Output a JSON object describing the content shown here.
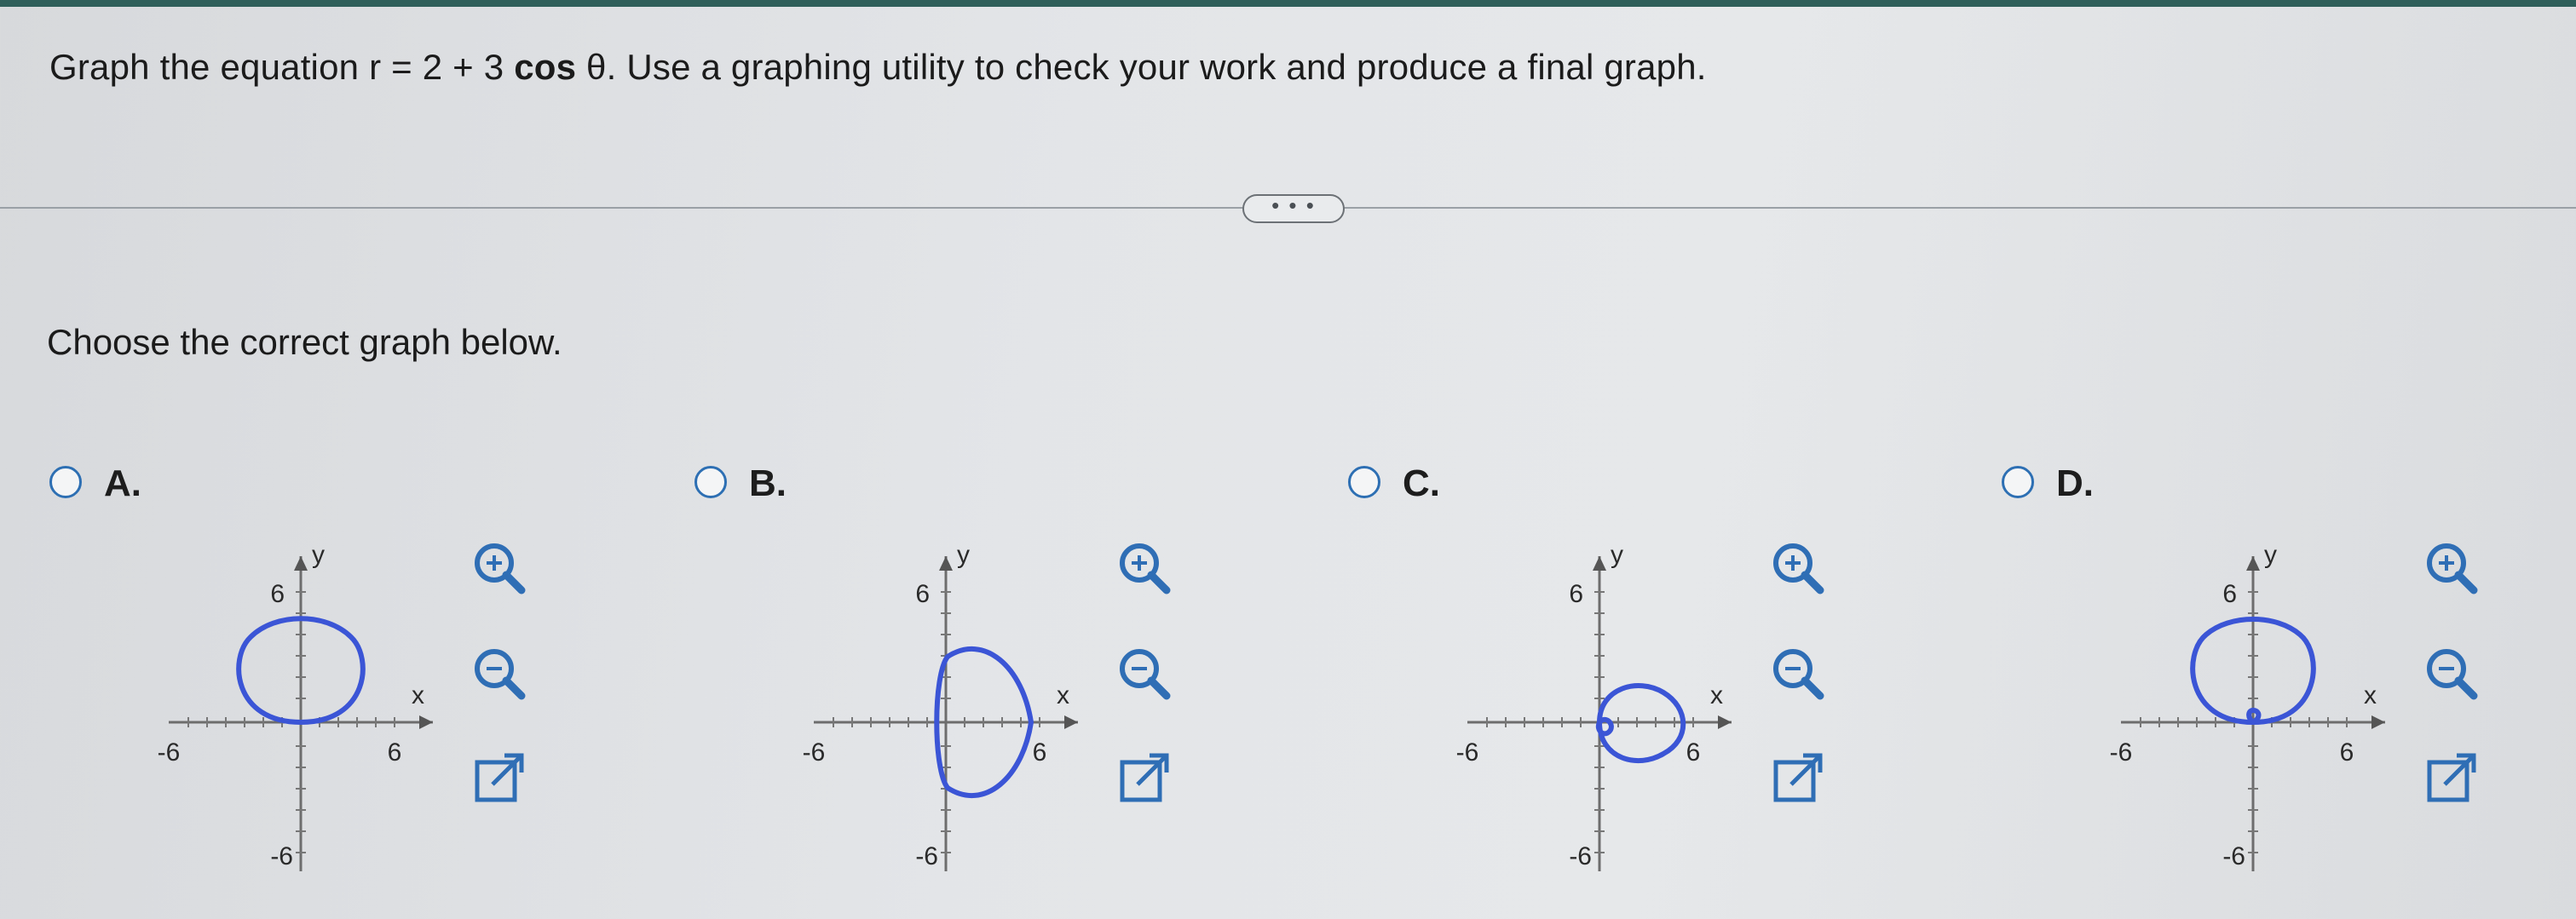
{
  "question": {
    "prefix": "Graph the equation r = 2 + 3",
    "cos": "cos",
    "theta": "θ",
    "suffix": ". Use a graphing utility to check your work and produce a final graph."
  },
  "more_button_label": "• • •",
  "instruction": "Choose the correct graph below.",
  "options": [
    {
      "letter": "A.",
      "ylabel": "y",
      "xlabel": "x",
      "ytick_top": "6",
      "ytick_bottom": "-6",
      "xtick_left": "-6",
      "xtick_right": "6"
    },
    {
      "letter": "B.",
      "ylabel": "y",
      "xlabel": "x",
      "ytick_top": "6",
      "ytick_bottom": "-6",
      "xtick_left": "-6",
      "xtick_right": "6"
    },
    {
      "letter": "C.",
      "ylabel": "y",
      "xlabel": "x",
      "ytick_top": "6",
      "ytick_bottom": "-6",
      "xtick_left": "-6",
      "xtick_right": "6"
    },
    {
      "letter": "D.",
      "ylabel": "y",
      "xlabel": "x",
      "ytick_top": "6",
      "ytick_bottom": "-6",
      "xtick_left": "-6",
      "xtick_right": "6"
    }
  ],
  "colors": {
    "curve": "#3b55d6",
    "radio": "#2d6fb3",
    "icon": "#2f6eb5"
  },
  "icons": [
    "zoom-in-icon",
    "zoom-out-icon",
    "popout-icon"
  ]
}
